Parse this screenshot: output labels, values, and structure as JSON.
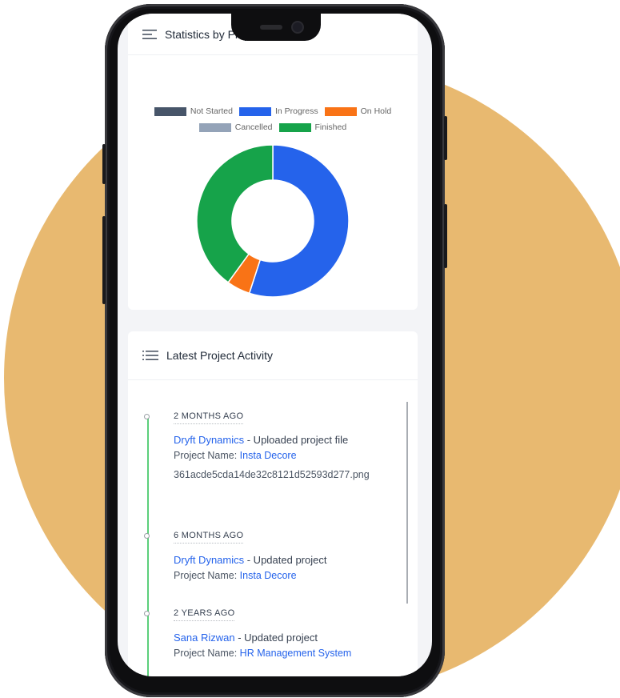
{
  "colors": {
    "background_circle": "#e8b970",
    "not_started": "#475569",
    "in_progress": "#2563eb",
    "on_hold": "#f97316",
    "cancelled": "#94a3b8",
    "finished": "#16a34a",
    "link": "#2563eb",
    "timeline": "#5ccf7a"
  },
  "status_card": {
    "title": "Statistics by Project Status",
    "icon": "hamburger-menu-icon"
  },
  "chart_data": {
    "type": "pie",
    "categories": [
      "Not Started",
      "In Progress",
      "On Hold",
      "Cancelled",
      "Finished"
    ],
    "values": [
      0,
      55,
      5,
      0,
      40
    ],
    "legend_position": "top",
    "donut": true
  },
  "activity_card": {
    "title": "Latest Project Activity",
    "icon": "list-icon",
    "entries": [
      {
        "time": "2 MONTHS AGO",
        "actor": "Dryft Dynamics",
        "action": " - Uploaded project file",
        "project_label": "Project Name: ",
        "project": "Insta Decore",
        "file": "361acde5cda14de32c8121d52593d277.png"
      },
      {
        "time": "6 MONTHS AGO",
        "actor": "Dryft Dynamics",
        "action": " - Updated project",
        "project_label": "Project Name: ",
        "project": "Insta Decore"
      },
      {
        "time": "2 YEARS AGO",
        "actor": "Sana Rizwan",
        "action": " - Updated project",
        "project_label": "Project Name: ",
        "project": "HR Management System"
      }
    ]
  }
}
